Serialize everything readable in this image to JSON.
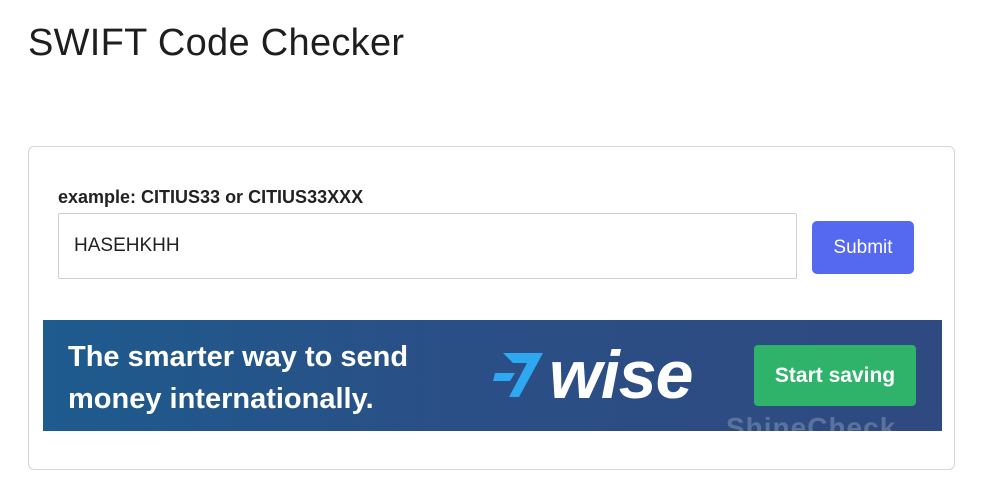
{
  "page": {
    "title": "SWIFT Code Checker"
  },
  "form": {
    "label": "example: CITIUS33 or CITIUS33XXX",
    "input_value": "HASEHKHH",
    "submit_label": "Submit"
  },
  "ad": {
    "tagline_line1": "The smarter way to send",
    "tagline_line2": "money internationally.",
    "brand": "wise",
    "cta_label": "Start saving",
    "watermark": "ShineCheck",
    "colors": {
      "background": "#2a4f86",
      "cta": "#2fb36a",
      "logo_mark": "#2ea8f0"
    }
  },
  "colors": {
    "submit_button": "#5468f0",
    "card_border": "#d6d6d6"
  }
}
